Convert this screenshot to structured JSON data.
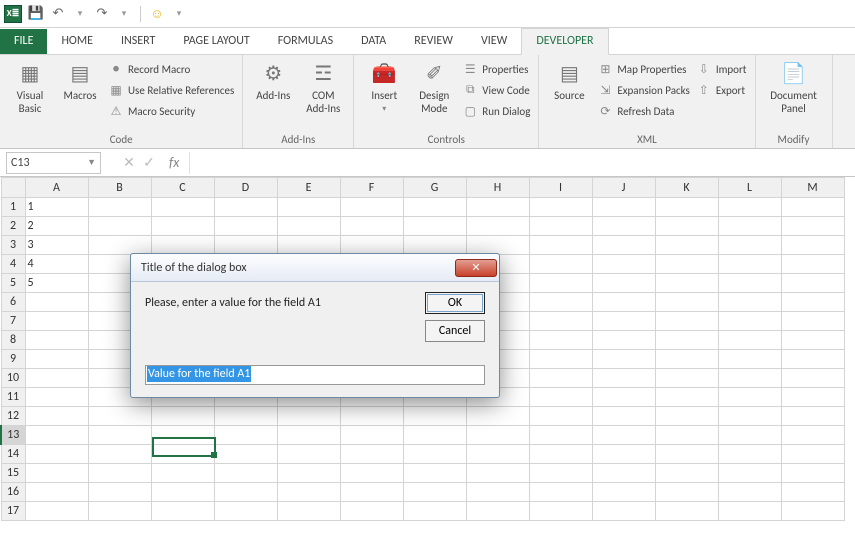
{
  "titlebar": {
    "app_icon": "X≣",
    "qat": {
      "save": "💾",
      "undo": "↶",
      "redo": "↷",
      "smiley": "☺"
    }
  },
  "tabs": {
    "file": "FILE",
    "home": "HOME",
    "insert": "INSERT",
    "pagelayout": "PAGE LAYOUT",
    "formulas": "FORMULAS",
    "data": "DATA",
    "review": "REVIEW",
    "view": "VIEW",
    "developer": "DEVELOPER"
  },
  "ribbon": {
    "code": {
      "visual_basic": "Visual Basic",
      "macros": "Macros",
      "record_macro": "Record Macro",
      "use_rel": "Use Relative References",
      "macro_sec": "Macro Security",
      "label": "Code"
    },
    "addins": {
      "addins": "Add-Ins",
      "com": "COM Add-Ins",
      "label": "Add-Ins"
    },
    "controls": {
      "insert": "Insert",
      "design": "Design Mode",
      "properties": "Properties",
      "view_code": "View Code",
      "run_dialog": "Run Dialog",
      "label": "Controls"
    },
    "xml": {
      "source": "Source",
      "map_props": "Map Properties",
      "expansion": "Expansion Packs",
      "refresh": "Refresh Data",
      "import": "Import",
      "export": "Export",
      "label": "XML"
    },
    "modify": {
      "doc_panel": "Document Panel",
      "label": "Modify"
    }
  },
  "formula_bar": {
    "name_box": "C13",
    "fx": "fx"
  },
  "grid": {
    "columns": [
      "A",
      "B",
      "C",
      "D",
      "E",
      "F",
      "G",
      "H",
      "I",
      "J",
      "K",
      "L",
      "M"
    ],
    "rows": 17,
    "selected_row": 13,
    "data": {
      "A1": "1",
      "A2": "2",
      "A3": "3",
      "A4": "4",
      "A5": "5"
    }
  },
  "dialog": {
    "title": "Title of the dialog box",
    "message": "Please, enter a value for the field A1",
    "ok": "OK",
    "cancel": "Cancel",
    "input_value": "Value for the field A1"
  }
}
